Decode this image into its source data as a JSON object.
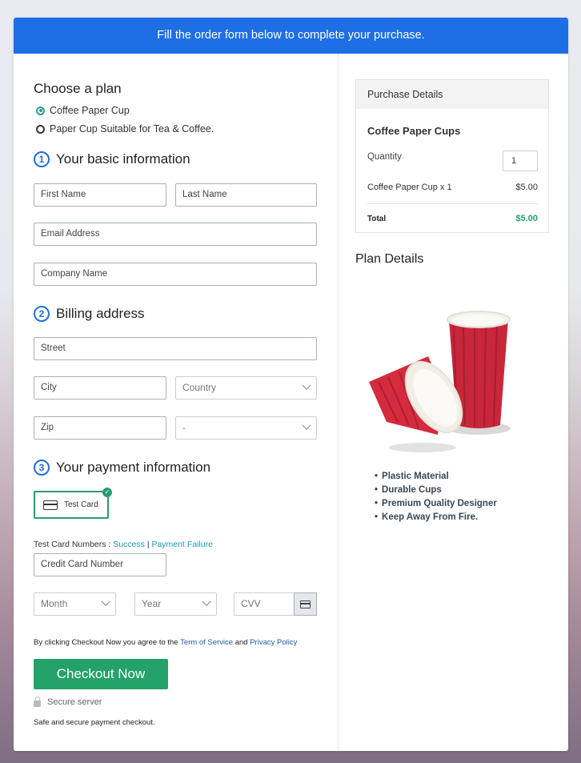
{
  "banner": {
    "text": "Fill the order form below to complete your purchase."
  },
  "plan": {
    "heading": "Choose a plan",
    "options": [
      {
        "label": "Coffee Paper Cup",
        "selected": true
      },
      {
        "label": "Paper Cup Suitable for Tea & Coffee.",
        "selected": false
      }
    ]
  },
  "basic": {
    "step": "1",
    "heading": "Your basic information",
    "first_name": "First Name",
    "last_name": "Last Name",
    "email": "Email Address",
    "company": "Company Name"
  },
  "billing": {
    "step": "2",
    "heading": "Billing address",
    "street": "Street",
    "city": "City",
    "country": "Country",
    "zip": "Zip",
    "state": "-"
  },
  "payment": {
    "step": "3",
    "heading": "Your payment information",
    "method": "Test Card",
    "test_numbers_label": "Test Card Numbers :",
    "success_link": "Success",
    "separator": "|",
    "failure_link": "Payment Failure",
    "card_number": "Credit Card Number",
    "month": "Month",
    "year": "Year",
    "cvv": "CVV"
  },
  "agree": {
    "prefix": "By clicking Checkout Now you agree to the",
    "terms": "Term of Service",
    "and": "and",
    "privacy": "Privacy Policy"
  },
  "checkout_label": "Checkout Now",
  "secure_label": "Secure server",
  "safe_label": "Safe and secure payment checkout.",
  "purchase": {
    "heading": "Purchase Details",
    "product": "Coffee Paper Cups",
    "quantity_label": "Quantity",
    "quantity_value": "1",
    "line_item": "Coffee Paper Cup x 1",
    "line_price": "$5.00",
    "total_label": "Total",
    "total_price": "$5.00"
  },
  "plan_details": {
    "heading": "Plan Details",
    "features": [
      "Plastic Material",
      "Durable Cups",
      "Premium Quality Designer",
      "Keep Away From Fire."
    ]
  },
  "colors": {
    "banner": "#1e6fe5",
    "checkout": "#23a26a",
    "total": "#23a26a",
    "link": "#1b9bb3"
  }
}
